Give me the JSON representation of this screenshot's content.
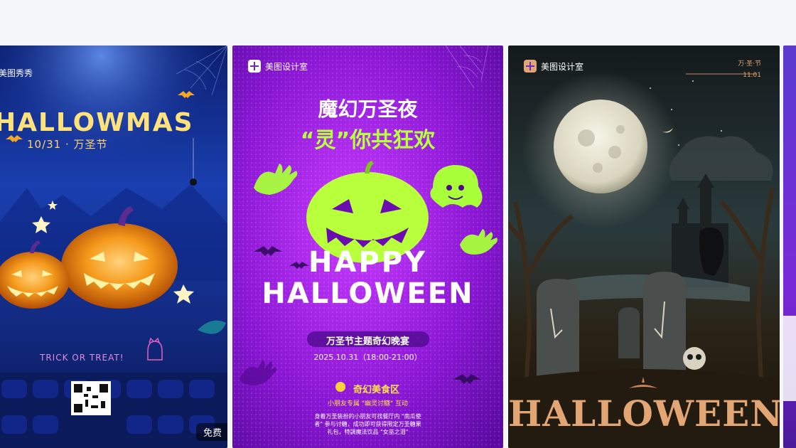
{
  "cards": [
    {
      "brand": "美图秀秀",
      "title": "HALLOWMAS",
      "date_line": "10/31 · 万圣节",
      "tagline": "TRICK OR TREAT!",
      "badge": "免费",
      "colors": {
        "bg_top": "#0f2e8f",
        "bg_bottom": "#0a1a5c",
        "pumpkin": "#f08a12"
      }
    },
    {
      "brand": "美图设计室",
      "headline_1": "魔幻万圣夜",
      "headline_2": "“灵”你共狂欢",
      "happy": "HAPPY",
      "halloween": "HALLOWEEN",
      "event_title": "万圣节主题奇幻晚宴",
      "event_time": "2025.10.31（18:00-21:00）",
      "section_title": "奇幻美食区",
      "section_sub": "小朋友专属 \"幽灵讨糖\" 互动",
      "body_line_1": "身着万圣装扮的小朋友可找餐厅内 \"南瓜使",
      "body_line_2": "者\" 参与讨糖，成功即可获得限定万圣糖果",
      "body_line_3": "礼包，特調魔法饮品 \"女巫之泪\"",
      "colors": {
        "bg": "#8a1ad6",
        "accent": "#b8ff3c"
      }
    },
    {
      "brand": "美图设计室",
      "corner_text": "万·圣·节",
      "corner_date": "11.01",
      "title": "HALLOWEEN",
      "colors": {
        "bg": "#1c1a16",
        "moon": "#e8e6d8",
        "title": "#e2a574"
      }
    }
  ]
}
